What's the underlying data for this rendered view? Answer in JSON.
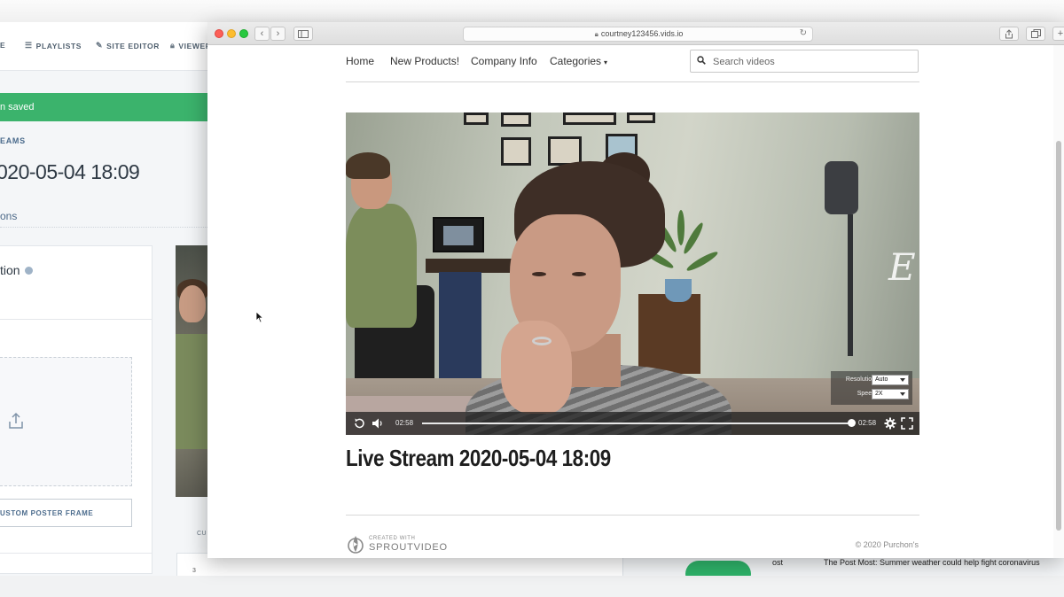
{
  "background_app": {
    "nav_items": [
      "E",
      "PLAYLISTS",
      "SITE EDITOR",
      "VIEWER"
    ],
    "banner_text": "n saved",
    "section_label": "EAMS",
    "title": "020-05-04 18:09",
    "tab_label": "ons",
    "card_heading": "tion",
    "poster_button": "USTOM POSTER FRAME",
    "chart_axis_value": "3",
    "cu_label": "CU",
    "news_left": "ost",
    "news_headline": "The Post Most: Summer weather could help fight coronavirus"
  },
  "browser": {
    "url": "courtney123456.vids.io"
  },
  "site": {
    "nav": [
      "Home",
      "New Products!",
      "Company Info",
      "Categories"
    ],
    "search_placeholder": "Search videos",
    "video_title": "Live Stream 2020-05-04 18:09",
    "footer_small": "CREATED WITH",
    "footer_brand": "SPROUTVIDEO",
    "copyright": "© 2020 Purchon's",
    "watermark": "E"
  },
  "player": {
    "current_time": "02:58",
    "duration": "02:58",
    "progress": 1.0,
    "resolution_label": "Resolution",
    "resolution_value": "Auto",
    "speed_label": "Speed",
    "speed_value": "2X"
  }
}
